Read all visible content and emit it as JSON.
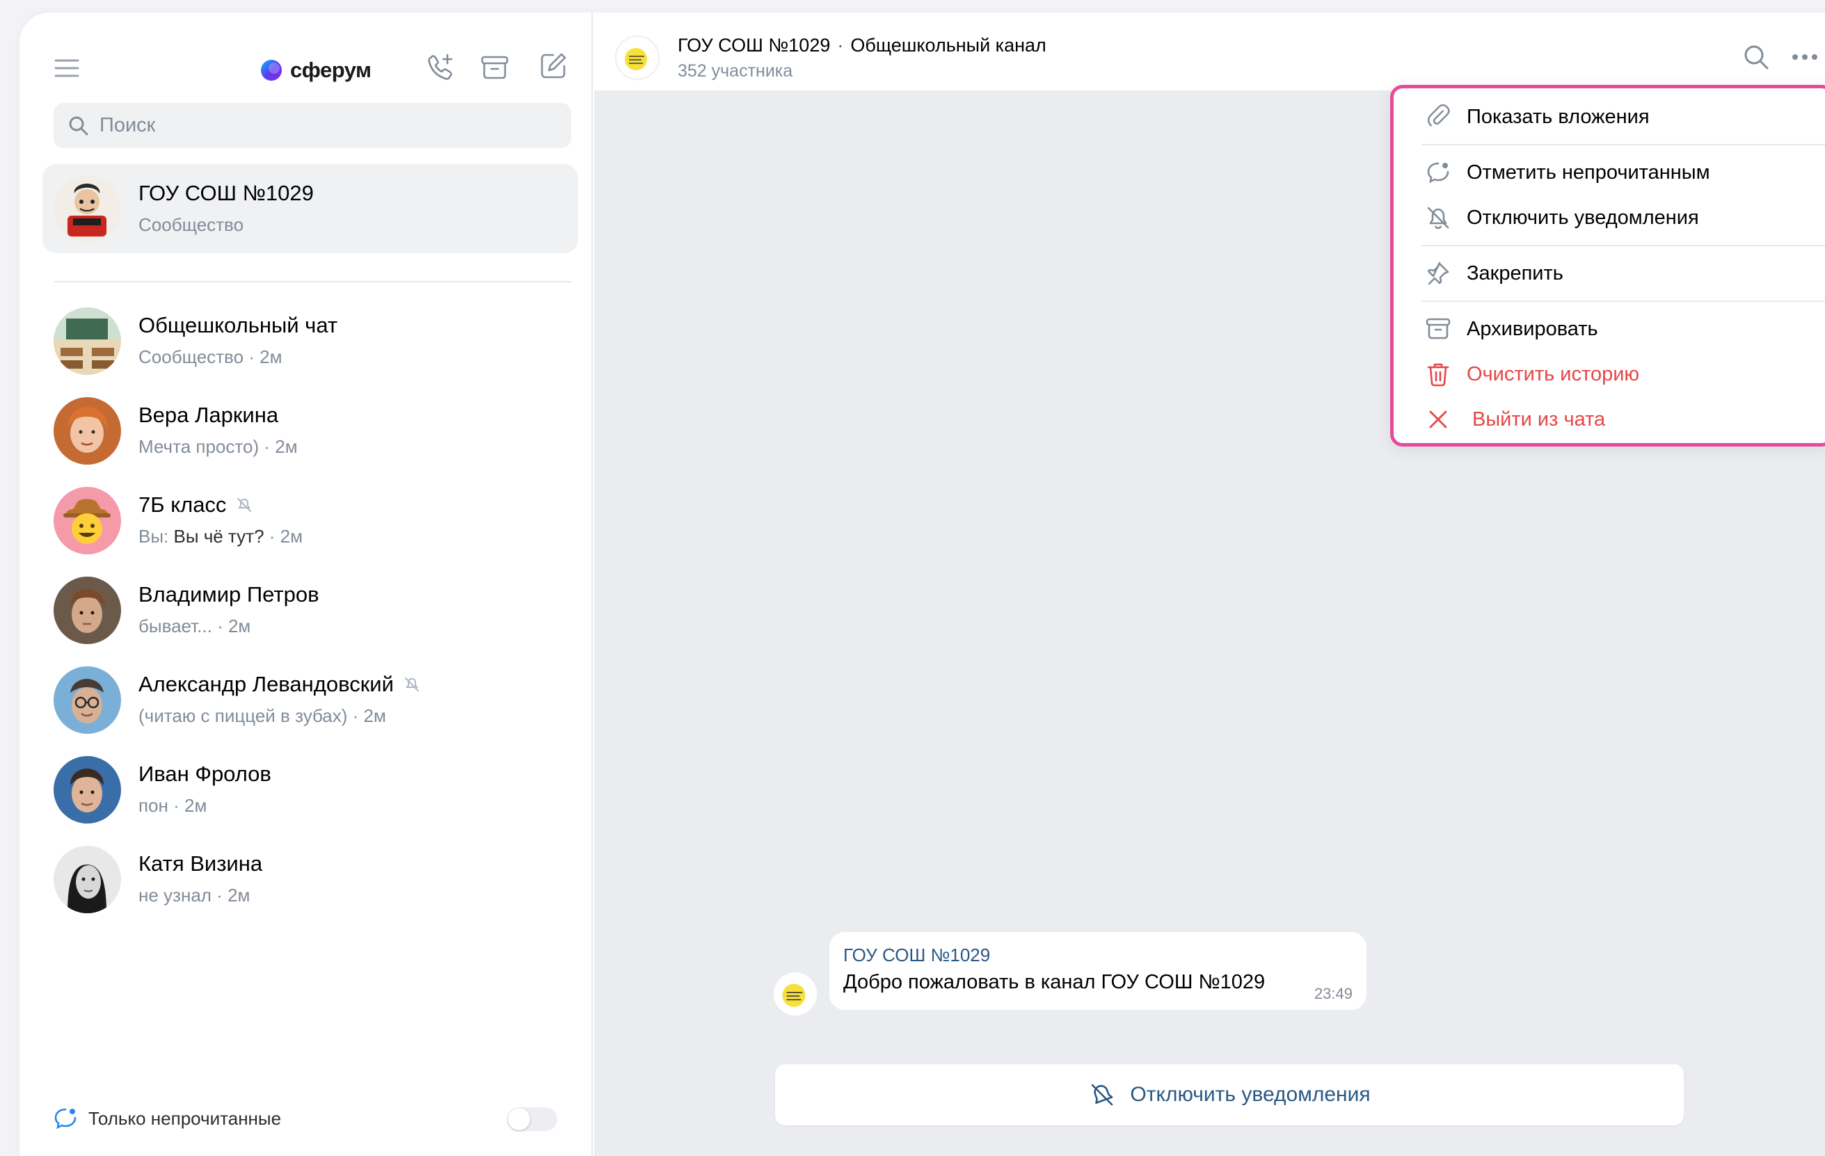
{
  "brand": {
    "name": "сферум",
    "accent": "#2688eb",
    "danger": "#e64646",
    "highlight": "#e64a9b"
  },
  "search": {
    "placeholder": "Поиск"
  },
  "chats": [
    {
      "name": "ГОУ СОШ №1029",
      "sub": "Сообщество",
      "time": "",
      "muted": false,
      "active": true
    },
    {
      "name": "Общешкольный чат",
      "sub": "Сообщество",
      "time": "2м",
      "muted": false
    },
    {
      "name": "Вера Ларкина",
      "sub": "Мечта просто)",
      "time": "2м",
      "muted": false
    },
    {
      "name": "7Б класс",
      "you": "Вы:",
      "sub": "Вы чё тут?",
      "time": "2м",
      "muted": true
    },
    {
      "name": "Владимир Петров",
      "sub": "бывает...",
      "time": "2м",
      "muted": false
    },
    {
      "name": "Александр Левандовский",
      "sub": "(читаю с пиццей в зубах)",
      "time": "2м",
      "muted": true
    },
    {
      "name": "Иван Фролов",
      "sub": "пон",
      "time": "2м",
      "muted": false
    },
    {
      "name": "Катя Визина",
      "sub": "не узнал",
      "time": "2м",
      "muted": false
    }
  ],
  "footer": {
    "unread_label": "Только непрочитанные",
    "unread_only": false
  },
  "header": {
    "title": "ГОУ СОШ №1029",
    "separator": "·",
    "channel": "Общешкольный канал",
    "members": "352 участника"
  },
  "message": {
    "author": "ГОУ СОШ №1029",
    "text": "Добро пожаловать в канал ГОУ СОШ №1029",
    "time": "23:49"
  },
  "mute_bar": {
    "label": "Отключить уведомления"
  },
  "menu": {
    "attachments": "Показать вложения",
    "mark_unread": "Отметить непрочитанным",
    "mute": "Отключить уведомления",
    "pin": "Закрепить",
    "archive": "Архивировать",
    "clear_history": "Очистить историю",
    "leave": "Выйти из чата"
  }
}
